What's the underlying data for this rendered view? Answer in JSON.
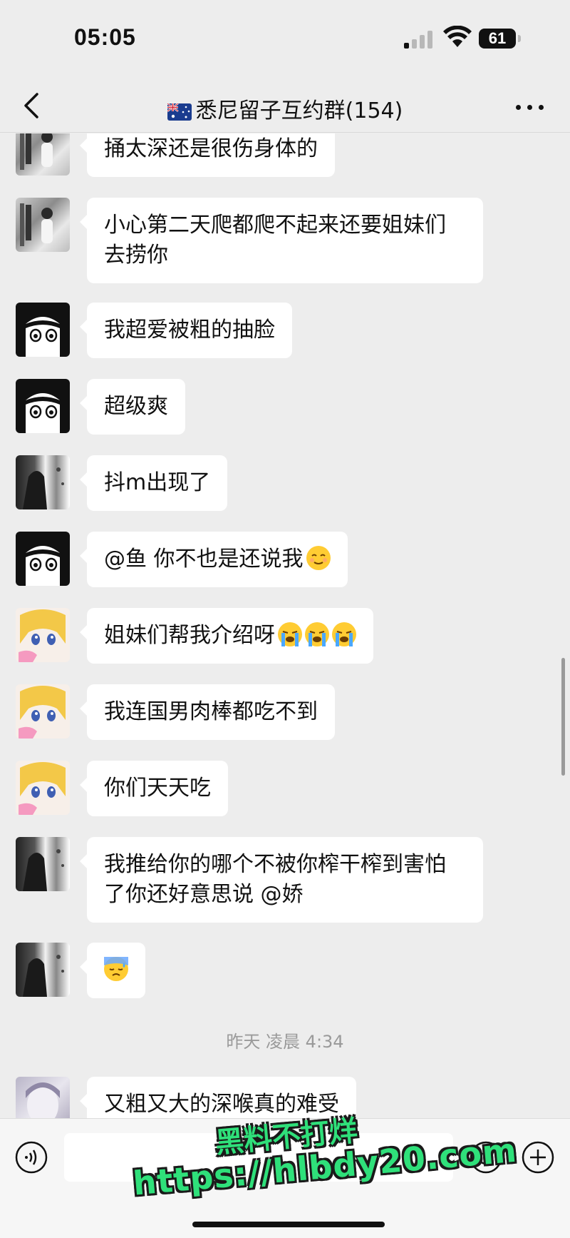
{
  "status_bar": {
    "time": "05:05",
    "battery": "61"
  },
  "header": {
    "title": "悉尼留子互约群(154)",
    "flag": "australia-flag-icon"
  },
  "messages": [
    {
      "avatar": "closet-photo-avatar",
      "text": "捅太深还是很伤身体的"
    },
    {
      "avatar": "closet-photo-avatar",
      "text": "小心第二天爬都爬不起来还要姐妹们去捞你"
    },
    {
      "avatar": "anime-girl-avatar",
      "text": "我超爱被粗的抽脸"
    },
    {
      "avatar": "anime-girl-avatar",
      "text": "超级爽"
    },
    {
      "avatar": "bw-figure-avatar",
      "text": "抖m出现了"
    },
    {
      "avatar": "anime-girl-avatar",
      "text": "@鱼 你不也是还说我"
    },
    {
      "avatar": "blonde-anime-avatar",
      "text": "姐妹们帮我介绍呀"
    },
    {
      "avatar": "blonde-anime-avatar",
      "text": "我连国男肉棒都吃不到"
    },
    {
      "avatar": "blonde-anime-avatar",
      "text": "你们天天吃"
    },
    {
      "avatar": "bw-figure-avatar",
      "text": "我推给你的哪个不被你榨干榨到害怕了你还好意思说 @娇"
    },
    {
      "avatar": "bw-figure-avatar",
      "text": ""
    },
    {
      "avatar": "soft-portrait-avatar",
      "text": "又粗又大的深喉真的难受"
    }
  ],
  "emojis": {
    "relieved": "relieved-face-emoji",
    "crying": "loudly-crying-face-emoji",
    "sweat": "downcast-sweat-face-emoji"
  },
  "timestamp": "昨天 凌晨 4:34",
  "input": {
    "placeholder": ""
  },
  "watermark": {
    "line1": "黑料不打烊",
    "line2": "https://hlbdy20.com"
  },
  "colors": {
    "background": "#ededed",
    "bubble": "#ffffff",
    "watermark": "#2fe07a"
  }
}
